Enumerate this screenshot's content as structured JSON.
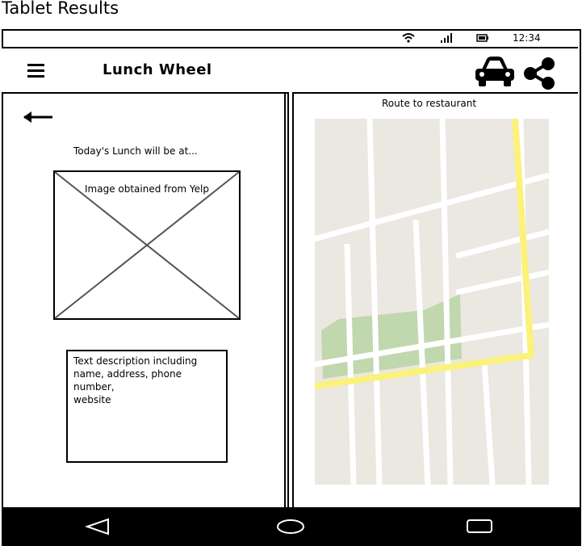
{
  "page": {
    "heading": "Tablet Results"
  },
  "status_bar": {
    "time": "12:34",
    "icons": [
      "wifi-icon",
      "signal-icon",
      "battery-icon"
    ]
  },
  "app_bar": {
    "title": "Lunch Wheel",
    "icons": [
      "menu-icon",
      "car-icon",
      "share-icon"
    ]
  },
  "left_pane": {
    "back_icon": "back-arrow-icon",
    "intro": "Today's Lunch will be at...",
    "image_placeholder_label": "Image obtained from Yelp",
    "description": "Text description including\nname, address, phone number,\nwebsite"
  },
  "right_pane": {
    "title": "Route to restaurant",
    "map_icon": "map-placeholder"
  },
  "nav_bar": {
    "icons": [
      "back-triangle-icon",
      "home-circle-icon",
      "recents-square-icon"
    ]
  }
}
